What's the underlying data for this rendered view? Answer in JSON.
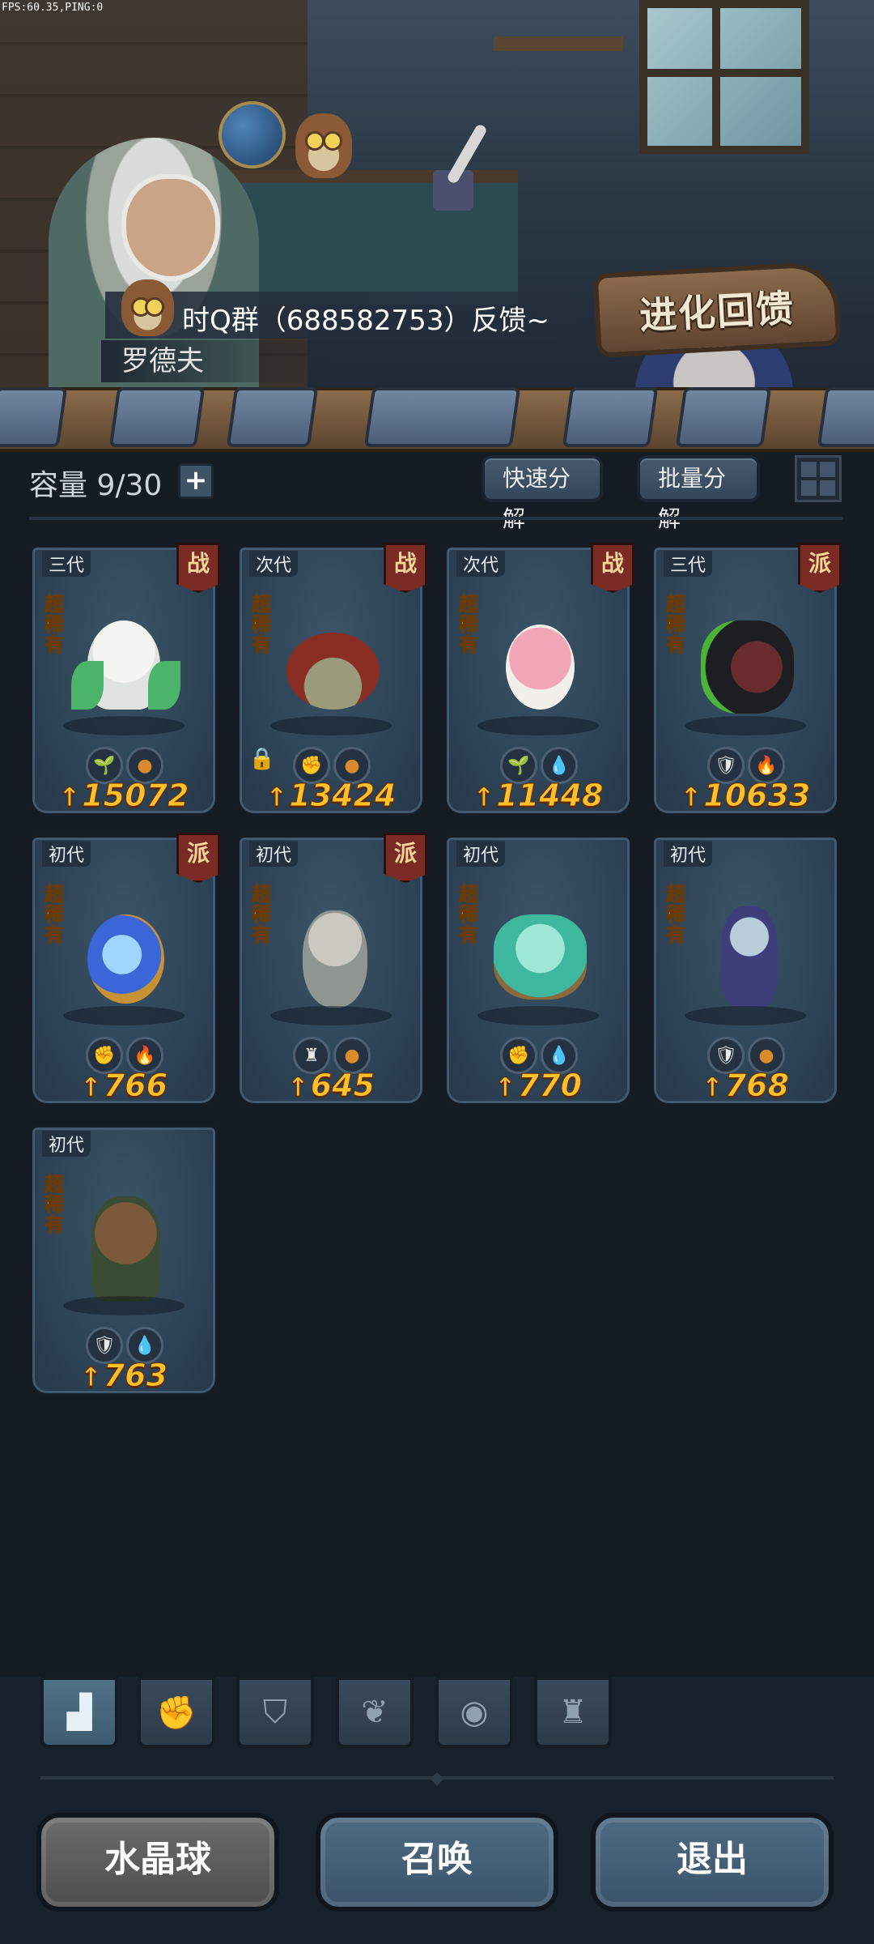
{
  "debug": {
    "fps_text": "FPS:60.35,PING:0"
  },
  "scene": {
    "dialog_text": "时Q群（688582753）反馈~",
    "npc_name": "罗德夫",
    "banner_text": "进化回馈"
  },
  "toolbar": {
    "capacity_label": "容量 9/30",
    "add_symbol": "+",
    "fast_decompose": "快速分解",
    "batch_decompose": "批量分解"
  },
  "rarity_label": "超稀有",
  "cards": [
    {
      "gen": "三代",
      "faction": "战",
      "power": "15072",
      "badges": [
        "sprout",
        "blob"
      ],
      "locked": false
    },
    {
      "gen": "次代",
      "faction": "战",
      "power": "13424",
      "badges": [
        "fist",
        "blob"
      ],
      "locked": true
    },
    {
      "gen": "次代",
      "faction": "战",
      "power": "11448",
      "badges": [
        "sprout",
        "drop"
      ],
      "locked": false
    },
    {
      "gen": "三代",
      "faction": "派",
      "power": "10633",
      "badges": [
        "shield",
        "fire"
      ],
      "locked": false
    },
    {
      "gen": "初代",
      "faction": "派",
      "power": "766",
      "badges": [
        "fist",
        "fire"
      ],
      "locked": false
    },
    {
      "gen": "初代",
      "faction": "派",
      "power": "645",
      "badges": [
        "tower",
        "blob"
      ],
      "locked": false
    },
    {
      "gen": "初代",
      "faction": "",
      "power": "770",
      "badges": [
        "fist",
        "drop"
      ],
      "locked": false
    },
    {
      "gen": "初代",
      "faction": "",
      "power": "768",
      "badges": [
        "shield",
        "blob"
      ],
      "locked": false
    },
    {
      "gen": "初代",
      "faction": "",
      "power": "763",
      "badges": [
        "shield",
        "drop"
      ],
      "locked": false
    }
  ],
  "filter_tabs": [
    "all-icon",
    "fist-icon",
    "shield-icon",
    "sprout-icon",
    "alien-icon",
    "tower-icon"
  ],
  "bottom_buttons": {
    "crystal": "水晶球",
    "summon": "召唤",
    "exit": "退出"
  },
  "colors": {
    "power": "#ffc02b",
    "rarity": "#f8b51d",
    "faction_badge": "#7a2b23"
  }
}
